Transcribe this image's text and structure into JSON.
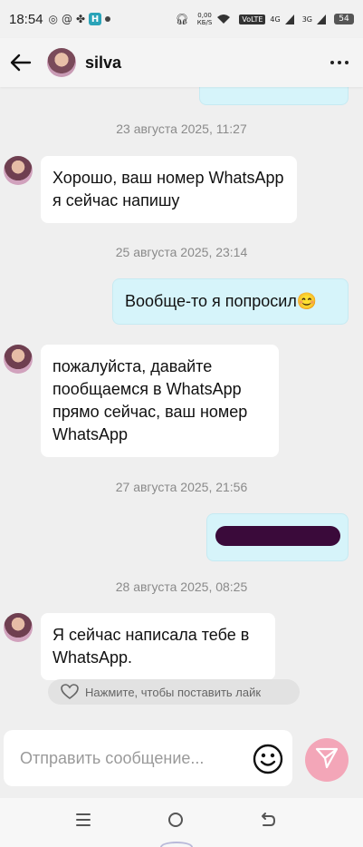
{
  "status_bar": {
    "time": "18:54",
    "net_speed": "0,00\nКБ/S",
    "volte": "VoLTE",
    "sig1": "4G",
    "sig2": "3G",
    "battery": "54"
  },
  "header": {
    "contact_name": "silva"
  },
  "messages": [
    {
      "timestamp": "23 августа 2025, 11:27"
    },
    {
      "direction": "in",
      "text": "Хорошо, ваш номер WhatsApp я сейчас напишу"
    },
    {
      "timestamp": "25 августа 2025, 23:14"
    },
    {
      "direction": "out",
      "text": "Вообще-то я попросил😊"
    },
    {
      "direction": "in",
      "text": "пожалуйста, давайте пообщаемся в WhatsApp прямо сейчас, ваш номер WhatsApp"
    },
    {
      "timestamp": "27 августа 2025, 21:56"
    },
    {
      "direction": "out",
      "text": ""
    },
    {
      "timestamp": "28 августа 2025, 08:25"
    },
    {
      "direction": "in",
      "text": "Я сейчас написала тебе в WhatsApp."
    }
  ],
  "like_hint": "Нажмите, чтобы поставить лайк",
  "composer": {
    "placeholder": "Отправить сообщение..."
  },
  "colors": {
    "outgoing_bubble": "#d6f4fa",
    "incoming_bubble": "#ffffff",
    "send_button": "#f3a6b8",
    "background": "#efefef"
  }
}
